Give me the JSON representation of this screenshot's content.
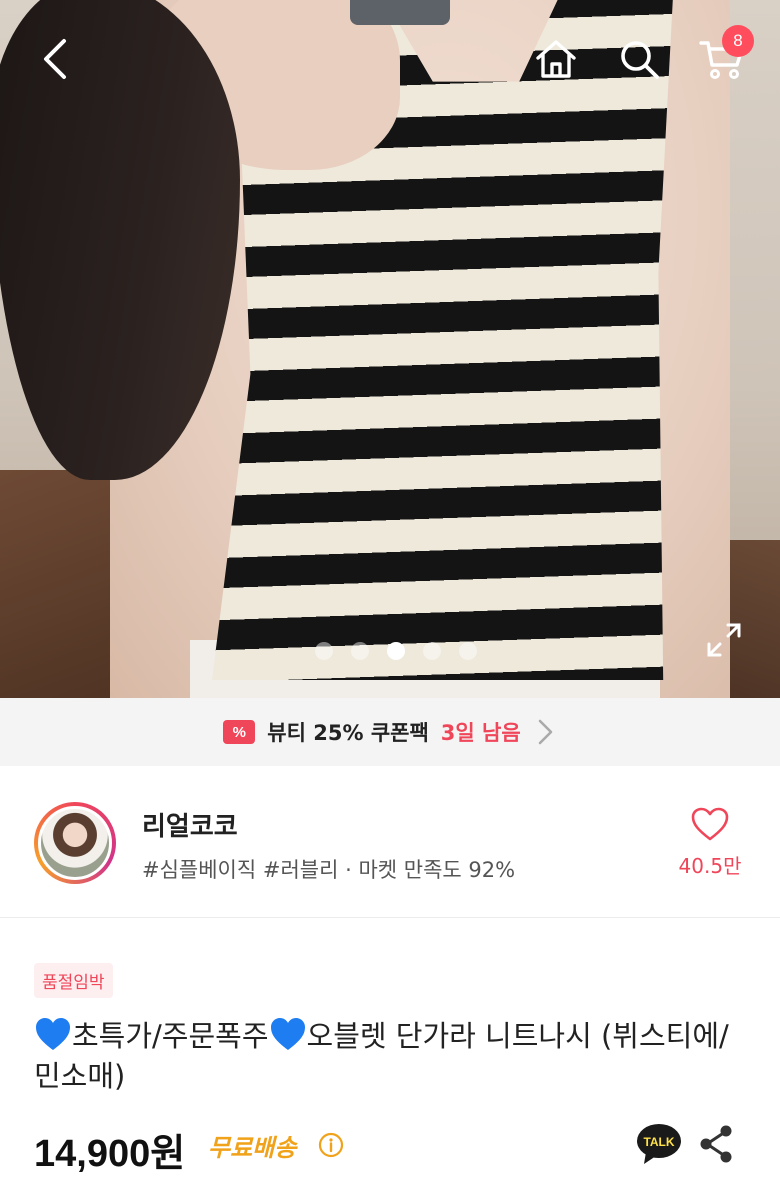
{
  "nav": {
    "back_icon": "chevron-left-icon",
    "home_icon": "home-icon",
    "search_icon": "search-icon",
    "cart_icon": "cart-icon",
    "cart_count": "8"
  },
  "gallery": {
    "image_count": 5,
    "active_index": 2,
    "expand_icon": "expand-icon"
  },
  "coupon": {
    "icon": "coupon-icon",
    "icon_glyph": "%",
    "text": "뷰티 25% 쿠폰팩",
    "remaining": "3일 남음"
  },
  "shop": {
    "name": "리얼코코",
    "tags": "#심플베이직 #러블리 · 마켓 만족도 92%",
    "likes": "40.5만"
  },
  "product": {
    "badge": "품절임박",
    "title_part1": "초특가/주문폭주",
    "title_part2": "오블렛 단가라 니트나시  (뷔스티에/민소매)",
    "price": "14,900원",
    "shipping": "무료배송"
  },
  "colors": {
    "accent": "#f0465a",
    "shipping": "#f0a21a",
    "blue_heart": "#1e7df0"
  }
}
